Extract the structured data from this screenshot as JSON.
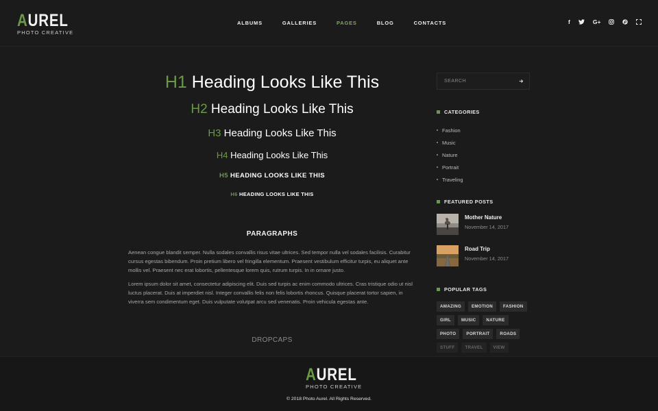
{
  "brand": {
    "first_letter": "A",
    "rest": "UREL",
    "subtitle": "PHOTO CREATIVE"
  },
  "nav": [
    {
      "label": "ALBUMS",
      "active": false
    },
    {
      "label": "GALLERIES",
      "active": false
    },
    {
      "label": "PAGES",
      "active": true
    },
    {
      "label": "BLOG",
      "active": false
    },
    {
      "label": "CONTACTS",
      "active": false
    }
  ],
  "social": {
    "facebook": "f",
    "googleplus": "G+",
    "icons": [
      "facebook-icon",
      "twitter-icon",
      "google-plus-icon",
      "instagram-icon",
      "pinterest-icon",
      "fullscreen-icon"
    ]
  },
  "headings": [
    {
      "tag": "H1",
      "text": "Heading Looks Like This"
    },
    {
      "tag": "H2",
      "text": "Heading Looks Like This"
    },
    {
      "tag": "H3",
      "text": "Heading Looks Like This"
    },
    {
      "tag": "H4",
      "text": "Heading Looks Like This"
    },
    {
      "tag": "H5",
      "text": "HEADING LOOKS LIKE THIS"
    },
    {
      "tag": "H6",
      "text": "HEADING LOOKS LIKE THIS"
    }
  ],
  "paragraphs": {
    "title": "PARAGRAPHS",
    "p1": "Aenean congue blandit semper. Nulla sodales convallis risus vitae ultrices. Sed tempor nulla vel sodales facilisis. Curabitur cursus egestas bibendum. Proin pretium libero vel fringilla elementum. Praesent vestibulum efficitur turpis, eu aliquet ante mollis vel. Praesent nec erat lobortis, pellentesque lorem quis, rutrum turpis. In in ornare justo.",
    "p2": "Lorem ipsum dolor sit amet, consectetur adipiscing elit. Duis sed turpis ac enim commodo ultrices. Cras tristique odio ut nisl luctus placerat. Duis at imperdiet nisl. Integer convallis felis non felis lobortis rhoncus. Quisque placerat tortor sapien, in viverra sem condimentum eget. Duis vulputate volutpat arcu sed venenatis. Proin vehicula egestas ante."
  },
  "dropcaps": {
    "title": "DROPCAPS"
  },
  "sidebar": {
    "search_placeholder": "SEARCH",
    "categories_title": "CATEGORIES",
    "categories": [
      "Fashion",
      "Music",
      "Nature",
      "Portrait",
      "Traveling"
    ],
    "featured_title": "FEATURED POSTS",
    "posts": [
      {
        "title": "Mother Nature",
        "date": "November 14, 2017"
      },
      {
        "title": "Road Trip",
        "date": "November 14, 2017"
      }
    ],
    "tags_title": "POPULAR TAGS",
    "tag_rows": [
      [
        "AMAZING",
        "EMOTION",
        "FASHION"
      ],
      [
        "GIRL",
        "MUSIC",
        "NATURE"
      ],
      [
        "PHOTO",
        "PORTRAIT",
        "ROADS"
      ],
      [
        "STUFF",
        "TRAVEL",
        "VIEW"
      ]
    ]
  },
  "footer": {
    "copyright": "© 2018 Photo Aurel. All Rights Reserved."
  },
  "colors": {
    "accent": "#6a9a47",
    "background": "#1b1b1b"
  }
}
